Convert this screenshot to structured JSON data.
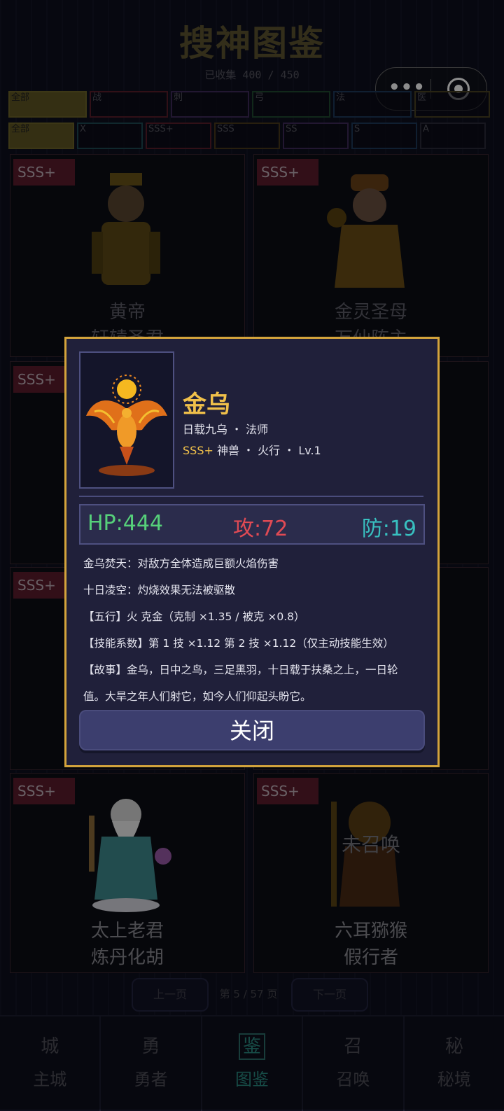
{
  "header": {
    "title": "搜神图鉴",
    "collected": "已收集 400 / 450"
  },
  "miniapp_capsule": {
    "more": "•••",
    "close_icon": "target-icon"
  },
  "filters": {
    "class_row": [
      "全部",
      "战",
      "刺",
      "弓",
      "法",
      "医"
    ],
    "rank_row": [
      "全部",
      "X",
      "SSS+",
      "SSS",
      "SS",
      "S",
      "A"
    ]
  },
  "cards": [
    {
      "rank": "SSS+",
      "name": "黄帝",
      "title": "轩辕圣君"
    },
    {
      "rank": "SSS+",
      "name": "金灵圣母",
      "title": "万仙阵主"
    },
    {
      "rank": "SSS+",
      "name": "",
      "title": ""
    },
    {
      "rank": "SSS+",
      "name": "",
      "title": ""
    },
    {
      "rank": "SSS+",
      "name": "太上老君",
      "title": "炼丹化胡"
    },
    {
      "rank": "SSS+",
      "name": "六耳猕猴",
      "title": "假行者",
      "status": "未召唤"
    }
  ],
  "pager": {
    "prev": "上一页",
    "info": "第 5 / 57 页",
    "next": "下一页"
  },
  "nav": [
    {
      "icon": "城",
      "label": "主城"
    },
    {
      "icon": "勇",
      "label": "勇者"
    },
    {
      "icon": "鉴",
      "label": "图鉴"
    },
    {
      "icon": "召",
      "label": "召唤"
    },
    {
      "icon": "秘",
      "label": "秘境"
    }
  ],
  "modal": {
    "name": "金乌",
    "subtitle": "日载九乌 ・ 法师",
    "rank": "SSS+",
    "tags": "神兽 ・ 火行 ・ Lv.1",
    "hp": "HP:444",
    "atk": "攻:72",
    "def": "防:19",
    "lines": [
      "金乌焚天：对敌方全体造成巨额火焰伤害",
      "十日凌空：灼烧效果无法被驱散",
      "【五行】火 克金（克制 ×1.35 / 被克 ×0.8）",
      "【技能系数】第 1 技 ×1.12 第 2 技 ×1.12（仅主动技能生效）",
      "【故事】金乌，日中之鸟，三足黑羽，十日载于扶桑之上，一日轮",
      "值。大旱之年人们射它，如今人们仰起头盼它。"
    ],
    "close": "关闭"
  },
  "colors": {
    "gold": "#f0c04a",
    "hp": "#56d07a",
    "atk": "#e04a54",
    "def": "#38c0c0",
    "rank_bg": "#5c1c2c"
  }
}
